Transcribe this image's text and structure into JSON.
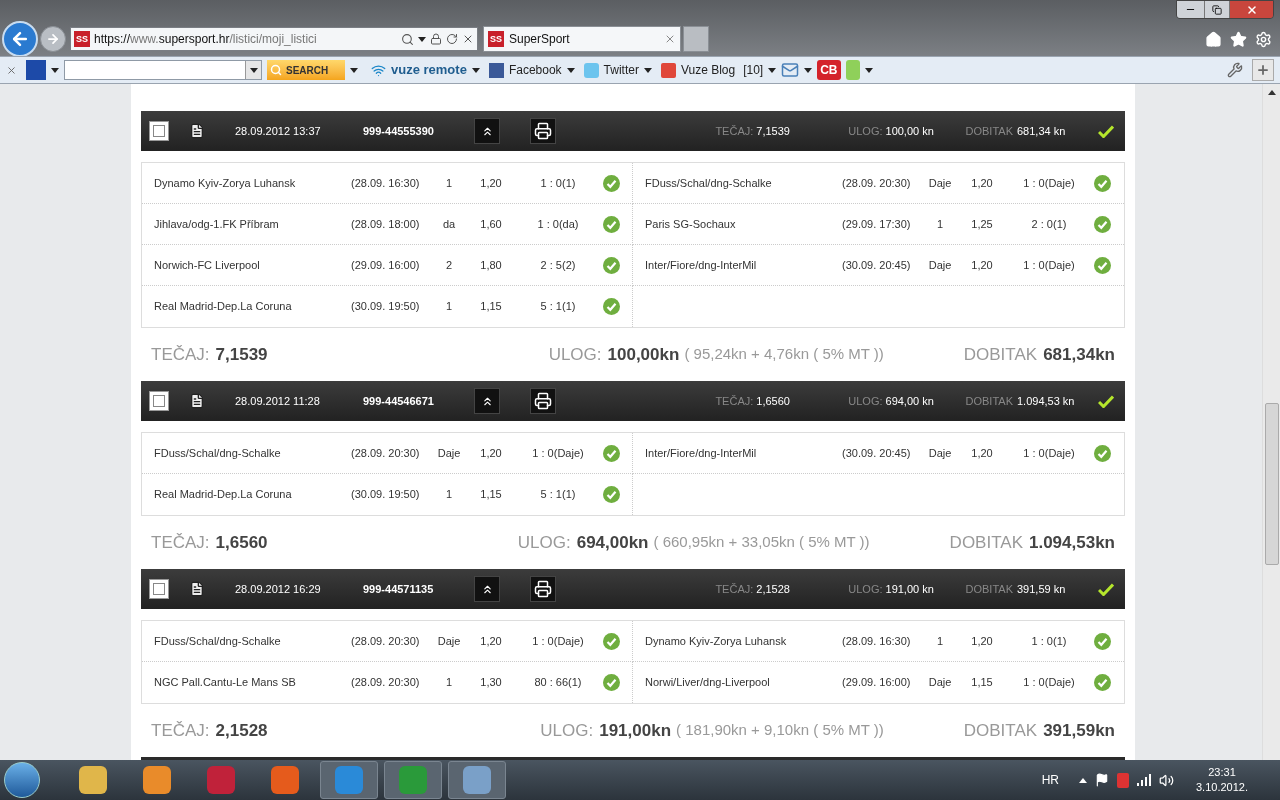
{
  "browser": {
    "favicon": "SS",
    "url_parts": [
      {
        "text": "https://",
        "dim": false
      },
      {
        "text": "www.",
        "dim": true
      },
      {
        "text": "supersport.hr",
        "dim": false
      },
      {
        "text": "/listici/moji_listici",
        "dim": true
      }
    ],
    "tab": {
      "favicon": "SS",
      "title": "SuperSport",
      "selected": true
    },
    "toolbar": {
      "search_button": "SEARCH",
      "vuze": "vuze remote",
      "links": [
        "Facebook",
        "Twitter"
      ],
      "blog": "Vuze Blog",
      "blog_count": "[10]",
      "cb": "CB"
    }
  },
  "tickets": [
    {
      "checked": false,
      "date": "28.09.2012 13:37",
      "id": "999-44555390",
      "won": true,
      "header": {
        "tecaj_label": "TEČAJ:",
        "tecaj": "7,1539",
        "ulog_label": "ULOG:",
        "ulog": "100,00 kn",
        "dobitak_label": "DOBITAK",
        "dobitak": "681,34 kn"
      },
      "matches": [
        {
          "teams": "Dynamo Kyiv-Zorya Luhansk",
          "time": "(28.09. 16:30)",
          "tip": "1",
          "odds": "1,20",
          "result": "1 : 0(1)",
          "won": true
        },
        {
          "teams": "FDuss/Schal/dng-Schalke",
          "time": "(28.09. 20:30)",
          "tip": "Daje",
          "odds": "1,20",
          "result": "1 : 0(Daje)",
          "won": true
        },
        {
          "teams": "Jihlava/odg-1.FK Příbram",
          "time": "(28.09. 18:00)",
          "tip": "da",
          "odds": "1,60",
          "result": "1 : 0(da)",
          "won": true
        },
        {
          "teams": "Paris SG-Sochaux",
          "time": "(29.09. 17:30)",
          "tip": "1",
          "odds": "1,25",
          "result": "2 : 0(1)",
          "won": true
        },
        {
          "teams": "Norwich-FC Liverpool",
          "time": "(29.09. 16:00)",
          "tip": "2",
          "odds": "1,80",
          "result": "2 : 5(2)",
          "won": true
        },
        {
          "teams": "Inter/Fiore/dng-InterMil",
          "time": "(30.09. 20:45)",
          "tip": "Daje",
          "odds": "1,20",
          "result": "1 : 0(Daje)",
          "won": true
        },
        {
          "teams": "Real Madrid-Dep.La Coruna",
          "time": "(30.09. 19:50)",
          "tip": "1",
          "odds": "1,15",
          "result": "5 : 1(1)",
          "won": true
        }
      ],
      "summary": {
        "tecaj_label": "TEČAJ:",
        "tecaj": "7,1539",
        "ulog_label": "ULOG:",
        "ulog": "100,00kn",
        "ulog_detail": "( 95,24kn + 4,76kn ( 5% MT ))",
        "dobitak_label": "DOBITAK",
        "dobitak": "681,34kn"
      }
    },
    {
      "checked": false,
      "date": "28.09.2012 11:28",
      "id": "999-44546671",
      "won": true,
      "header": {
        "tecaj_label": "TEČAJ:",
        "tecaj": "1,6560",
        "ulog_label": "ULOG:",
        "ulog": "694,00 kn",
        "dobitak_label": "DOBITAK",
        "dobitak": "1.094,53 kn"
      },
      "matches": [
        {
          "teams": "FDuss/Schal/dng-Schalke",
          "time": "(28.09. 20:30)",
          "tip": "Daje",
          "odds": "1,20",
          "result": "1 : 0(Daje)",
          "won": true
        },
        {
          "teams": "Inter/Fiore/dng-InterMil",
          "time": "(30.09. 20:45)",
          "tip": "Daje",
          "odds": "1,20",
          "result": "1 : 0(Daje)",
          "won": true
        },
        {
          "teams": "Real Madrid-Dep.La Coruna",
          "time": "(30.09. 19:50)",
          "tip": "1",
          "odds": "1,15",
          "result": "5 : 1(1)",
          "won": true
        }
      ],
      "summary": {
        "tecaj_label": "TEČAJ:",
        "tecaj": "1,6560",
        "ulog_label": "ULOG:",
        "ulog": "694,00kn",
        "ulog_detail": "( 660,95kn + 33,05kn ( 5% MT ))",
        "dobitak_label": "DOBITAK",
        "dobitak": "1.094,53kn"
      }
    },
    {
      "checked": false,
      "date": "28.09.2012 16:29",
      "id": "999-44571135",
      "won": true,
      "header": {
        "tecaj_label": "TEČAJ:",
        "tecaj": "2,1528",
        "ulog_label": "ULOG:",
        "ulog": "191,00 kn",
        "dobitak_label": "DOBITAK",
        "dobitak": "391,59 kn"
      },
      "matches": [
        {
          "teams": "FDuss/Schal/dng-Schalke",
          "time": "(28.09. 20:30)",
          "tip": "Daje",
          "odds": "1,20",
          "result": "1 : 0(Daje)",
          "won": true
        },
        {
          "teams": "Dynamo Kyiv-Zorya Luhansk",
          "time": "(28.09. 16:30)",
          "tip": "1",
          "odds": "1,20",
          "result": "1 : 0(1)",
          "won": true
        },
        {
          "teams": "NGC Pall.Cantu-Le Mans SB",
          "time": "(28.09. 20:30)",
          "tip": "1",
          "odds": "1,30",
          "result": "80 : 66(1)",
          "won": true
        },
        {
          "teams": "Norwi/Liver/dng-Liverpool",
          "time": "(29.09. 16:00)",
          "tip": "Daje",
          "odds": "1,15",
          "result": "1 : 0(Daje)",
          "won": true
        }
      ],
      "summary": {
        "tecaj_label": "TEČAJ:",
        "tecaj": "2,1528",
        "ulog_label": "ULOG:",
        "ulog": "191,00kn",
        "ulog_detail": "( 181,90kn + 9,10kn ( 5% MT ))",
        "dobitak_label": "DOBITAK",
        "dobitak": "391,59kn"
      }
    }
  ],
  "taskbar": {
    "language": "HR",
    "time": "23:31",
    "date": "3.10.2012."
  }
}
